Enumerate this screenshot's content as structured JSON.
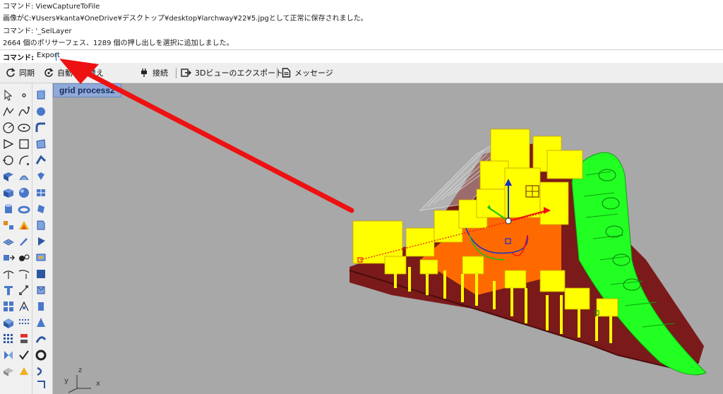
{
  "command_history": [
    "コマンド: ViewCaptureToFile",
    "画像がC:¥Users¥kanta¥OneDrive¥デスクトップ¥desktop¥larchway¥22¥5.jpgとして正常に保存されました。",
    "コマンド: '_SelLayer",
    "2664 個のポリサーフェス、1289 個の押し出しを選択に追加しました。"
  ],
  "command_prompt": {
    "label": "コマンド:",
    "value": "Export"
  },
  "toolbar": {
    "sync": "同期",
    "auto_switch": "自動切り替え",
    "connect": "接続",
    "export_3d": "3Dビューのエクスポート",
    "message": "メッセージ"
  },
  "viewport": {
    "tab_label": "grid process2",
    "axes": {
      "x": "x",
      "y": "y",
      "z": "z"
    }
  },
  "colors": {
    "annotation_arrow": "#ee1111",
    "selected_mass": "#ffff00",
    "green_tube": "#22ff22",
    "base_slab": "#7a1a1a",
    "viewport_bg": "#a8a8a8",
    "tab_bg": "#8fa9d9"
  },
  "icons": [
    "sync-icon",
    "auto-switch-icon",
    "plug-icon",
    "export-icon",
    "message-icon",
    "arrow-icon",
    "point-icon",
    "curve-icon",
    "circle-icon",
    "arc-icon",
    "polygon-icon",
    "rectangle-icon",
    "surface-icon",
    "box-icon",
    "sphere-icon",
    "cylinder-icon",
    "boolean-icon",
    "mesh-icon",
    "text-icon",
    "grid-icon",
    "check-icon",
    "dimension-icon"
  ]
}
